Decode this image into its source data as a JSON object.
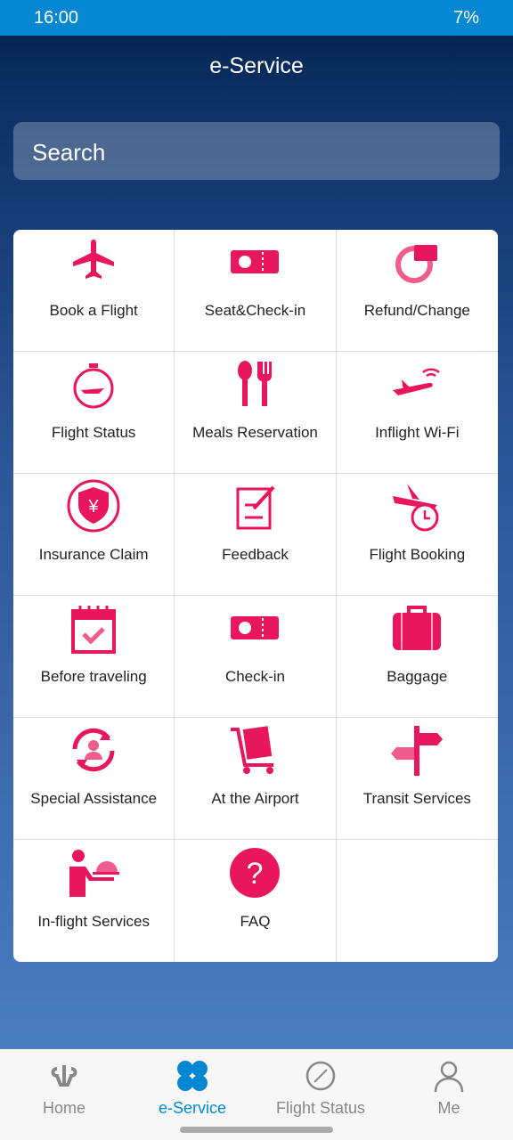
{
  "status": {
    "time": "16:00",
    "battery": "7%"
  },
  "header": {
    "title": "e-Service"
  },
  "search": {
    "placeholder": "Search"
  },
  "colors": {
    "accent": "#e8175d",
    "active_tab": "#0588d1"
  },
  "services": [
    {
      "label": "Book a Flight",
      "icon": "airplane-icon"
    },
    {
      "label": "Seat&Check-in",
      "icon": "ticket-icon"
    },
    {
      "label": "Refund/Change",
      "icon": "refund-icon"
    },
    {
      "label": "Flight Status",
      "icon": "stopwatch-plane-icon"
    },
    {
      "label": "Meals Reservation",
      "icon": "spoon-fork-icon"
    },
    {
      "label": "Inflight Wi-Fi",
      "icon": "plane-wifi-icon"
    },
    {
      "label": "Insurance Claim",
      "icon": "yen-shield-icon"
    },
    {
      "label": "Feedback",
      "icon": "edit-note-icon"
    },
    {
      "label": "Flight Booking",
      "icon": "plane-clock-icon"
    },
    {
      "label": "Before traveling",
      "icon": "calendar-check-icon"
    },
    {
      "label": "Check-in",
      "icon": "ticket-icon"
    },
    {
      "label": "Baggage",
      "icon": "suitcase-icon"
    },
    {
      "label": "Special Assistance",
      "icon": "assistance-icon"
    },
    {
      "label": "At the Airport",
      "icon": "luggage-cart-icon"
    },
    {
      "label": "Transit Services",
      "icon": "signpost-icon"
    },
    {
      "label": "In-flight Services",
      "icon": "waiter-cloche-icon"
    },
    {
      "label": "FAQ",
      "icon": "question-icon"
    }
  ],
  "nav": [
    {
      "label": "Home",
      "icon": "home-logo-icon"
    },
    {
      "label": "e-Service",
      "icon": "clover-icon",
      "active": true
    },
    {
      "label": "Flight Status",
      "icon": "compass-icon"
    },
    {
      "label": "Me",
      "icon": "person-icon"
    }
  ]
}
